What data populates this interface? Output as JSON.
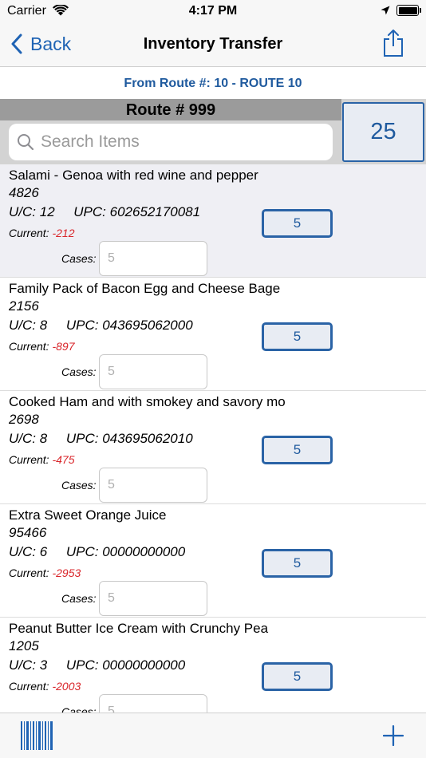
{
  "status_bar": {
    "carrier": "Carrier",
    "time": "4:17 PM"
  },
  "nav": {
    "back_label": "Back",
    "title": "Inventory Transfer"
  },
  "from_route": "From Route #: 10 - ROUTE 10",
  "route": {
    "title": "Route # 999",
    "count": "25"
  },
  "search": {
    "placeholder": "Search Items"
  },
  "list": {
    "uc_prefix": "U/C:",
    "upc_prefix": "UPC:",
    "current_label": "Current:",
    "cases_label": "Cases:",
    "items": [
      {
        "name": "Salami  - Genoa with red wine and pepper",
        "number": "4826",
        "uc": "12",
        "upc": "602652170081",
        "current": "-212",
        "qty": "5",
        "cases_placeholder": "5",
        "highlighted": true
      },
      {
        "name": "Family Pack of Bacon Egg and Cheese Bage",
        "number": "2156",
        "uc": "8",
        "upc": "043695062000",
        "current": "-897",
        "qty": "5",
        "cases_placeholder": "5",
        "highlighted": false
      },
      {
        "name": "Cooked Ham and with smokey and savory mo",
        "number": "2698",
        "uc": "8",
        "upc": "043695062010",
        "current": "-475",
        "qty": "5",
        "cases_placeholder": "5",
        "highlighted": false
      },
      {
        "name": "Extra Sweet Orange Juice",
        "number": "95466",
        "uc": "6",
        "upc": "00000000000",
        "current": "-2953",
        "qty": "5",
        "cases_placeholder": "5",
        "highlighted": false
      },
      {
        "name": "Peanut Butter Ice Cream with Crunchy Pea",
        "number": "1205",
        "uc": "3",
        "upc": "00000000000",
        "current": "-2003",
        "qty": "5",
        "cases_placeholder": "5",
        "highlighted": false
      }
    ]
  },
  "toolbar": {
    "left_icon": "barcode-icon",
    "right_icon": "plus-icon"
  },
  "colors": {
    "accent": "#1f63b4",
    "current_value": "#d9262b",
    "route_strip": "#9b9b9b"
  }
}
